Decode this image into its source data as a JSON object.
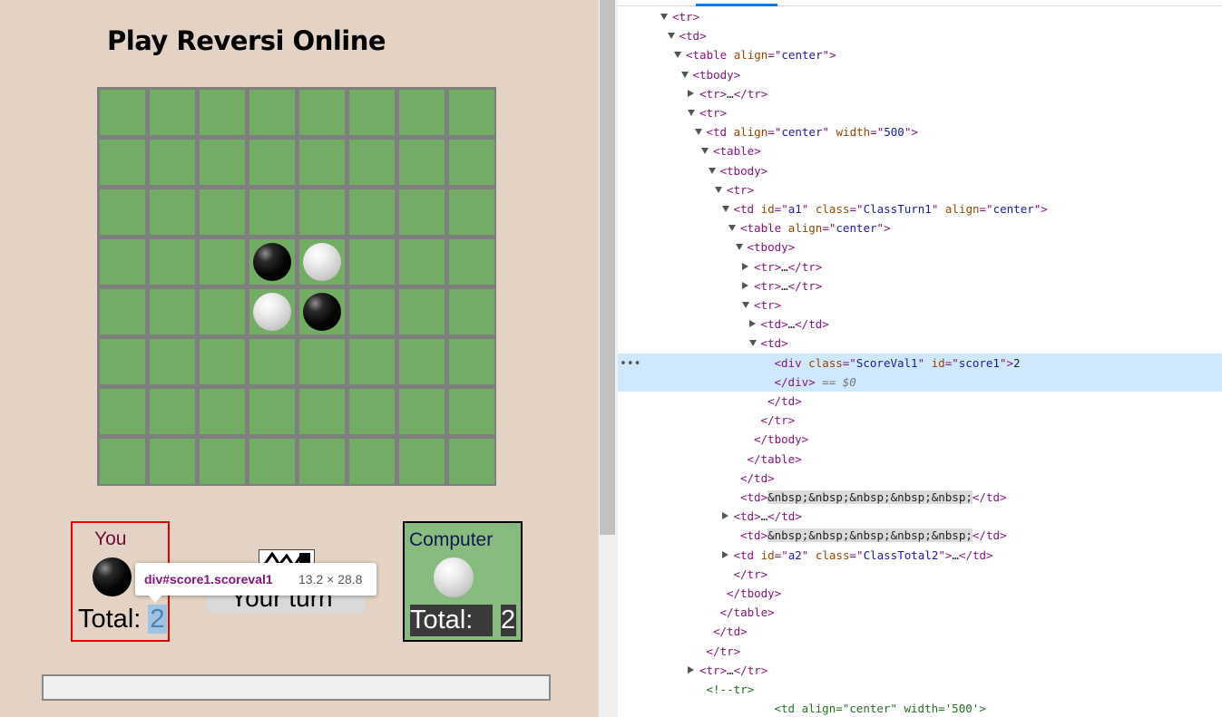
{
  "game": {
    "title": "Play Reversi Online",
    "board": {
      "rows": 8,
      "cols": 8,
      "discs": [
        {
          "row": 3,
          "col": 3,
          "color": "black"
        },
        {
          "row": 3,
          "col": 4,
          "color": "white"
        },
        {
          "row": 4,
          "col": 3,
          "color": "white"
        },
        {
          "row": 4,
          "col": 4,
          "color": "black"
        }
      ]
    },
    "player": {
      "label": "You",
      "total_label": "Total:",
      "score": "2"
    },
    "computer": {
      "label": "Computer",
      "total_label": "Total:",
      "score": "2"
    },
    "turn_text": "Your turn",
    "tooltip": {
      "selector": "div#score1.scoreval1",
      "size": "13.2 × 28.8"
    }
  },
  "colors": {
    "board_green": "#73ac65",
    "grid_gray": "#7f7f7f",
    "page_bg": "#e4d3c4",
    "player_border": "#e00000",
    "computer_bg": "#88bb80",
    "selection_highlight": "#cfe8fc"
  },
  "devtools": {
    "highlighted_line": 18,
    "lines": [
      {
        "indent": 8,
        "tri": "down",
        "html": "<span class='t'>&lt;tr&gt;</span>"
      },
      {
        "indent": 9,
        "tri": "down",
        "html": "<span class='t'>&lt;td&gt;</span>"
      },
      {
        "indent": 10,
        "tri": "down",
        "html": "<span class='t'>&lt;table </span><span class='a'>align</span><span class='t'>=\"</span><span class='v'>center</span><span class='t'>\"&gt;</span>"
      },
      {
        "indent": 11,
        "tri": "down",
        "html": "<span class='t'>&lt;tbody&gt;</span>"
      },
      {
        "indent": 12,
        "tri": "right",
        "html": "<span class='t'>&lt;tr&gt;</span><span class='k'>…</span><span class='t'>&lt;/tr&gt;</span>"
      },
      {
        "indent": 12,
        "tri": "down",
        "html": "<span class='t'>&lt;tr&gt;</span>"
      },
      {
        "indent": 13,
        "tri": "down",
        "html": "<span class='t'>&lt;td </span><span class='a'>align</span><span class='t'>=\"</span><span class='v'>center</span><span class='t'>\" </span><span class='a'>width</span><span class='t'>=\"</span><span class='v'>500</span><span class='t'>\"&gt;</span>"
      },
      {
        "indent": 14,
        "tri": "down",
        "html": "<span class='t'>&lt;table&gt;</span>"
      },
      {
        "indent": 15,
        "tri": "down",
        "html": "<span class='t'>&lt;tbody&gt;</span>"
      },
      {
        "indent": 16,
        "tri": "down",
        "html": "<span class='t'>&lt;tr&gt;</span>"
      },
      {
        "indent": 17,
        "tri": "down",
        "html": "<span class='t'>&lt;td </span><span class='a'>id</span><span class='t'>=\"</span><span class='v'>a1</span><span class='t'>\" </span><span class='a'>class</span><span class='t'>=\"</span><span class='v'>ClassTurn1</span><span class='t'>\" </span><span class='a'>align</span><span class='t'>=\"</span><span class='v'>center</span><span class='t'>\"&gt;</span>"
      },
      {
        "indent": 18,
        "tri": "down",
        "html": "<span class='t'>&lt;table </span><span class='a'>align</span><span class='t'>=\"</span><span class='v'>center</span><span class='t'>\"&gt;</span>"
      },
      {
        "indent": 19,
        "tri": "down",
        "html": "<span class='t'>&lt;tbody&gt;</span>"
      },
      {
        "indent": 20,
        "tri": "right",
        "html": "<span class='t'>&lt;tr&gt;</span><span class='k'>…</span><span class='t'>&lt;/tr&gt;</span>"
      },
      {
        "indent": 20,
        "tri": "right",
        "html": "<span class='t'>&lt;tr&gt;</span><span class='k'>…</span><span class='t'>&lt;/tr&gt;</span>"
      },
      {
        "indent": 20,
        "tri": "down",
        "html": "<span class='t'>&lt;tr&gt;</span>"
      },
      {
        "indent": 21,
        "tri": "right",
        "html": "<span class='t'>&lt;td&gt;</span><span class='k'>…</span><span class='t'>&lt;/td&gt;</span>"
      },
      {
        "indent": 21,
        "tri": "down",
        "html": "<span class='t'>&lt;td&gt;</span>"
      },
      {
        "indent": 23,
        "tri": "",
        "html": "<span class='t'>&lt;div </span><span class='a'>class</span><span class='t'>=\"</span><span class='v'>ScoreVal1</span><span class='t'>\" </span><span class='a'>id</span><span class='t'>=\"</span><span class='v'>score1</span><span class='t'>\"&gt;</span><span class='k'>2</span>"
      },
      {
        "indent": 23,
        "tri": "",
        "html": "<span class='t'>&lt;/div&gt;</span><span class='g'> == $0</span>"
      },
      {
        "indent": 22,
        "tri": "",
        "html": "<span class='t'>&lt;/td&gt;</span>"
      },
      {
        "indent": 21,
        "tri": "",
        "html": "<span class='t'>&lt;/tr&gt;</span>"
      },
      {
        "indent": 20,
        "tri": "",
        "html": "<span class='t'>&lt;/tbody&gt;</span>"
      },
      {
        "indent": 19,
        "tri": "",
        "html": "<span class='t'>&lt;/table&gt;</span>"
      },
      {
        "indent": 18,
        "tri": "",
        "html": "<span class='t'>&lt;/td&gt;</span>"
      },
      {
        "indent": 18,
        "tri": "",
        "html": "<span class='t'>&lt;td&gt;</span><span class='n'>&amp;nbsp;&amp;nbsp;&amp;nbsp;&amp;nbsp;&amp;nbsp;</span><span class='t'>&lt;/td&gt;</span>"
      },
      {
        "indent": 17,
        "tri": "right",
        "html": "<span class='t'>&lt;td&gt;</span><span class='k'>…</span><span class='t'>&lt;/td&gt;</span>"
      },
      {
        "indent": 18,
        "tri": "",
        "html": "<span class='t'>&lt;td&gt;</span><span class='n'>&amp;nbsp;&amp;nbsp;&amp;nbsp;&amp;nbsp;&amp;nbsp;</span><span class='t'>&lt;/td&gt;</span>"
      },
      {
        "indent": 17,
        "tri": "right",
        "html": "<span class='t'>&lt;td </span><span class='a'>id</span><span class='t'>=\"</span><span class='v'>a2</span><span class='t'>\" </span><span class='a'>class</span><span class='t'>=\"</span><span class='v'>ClassTotal2</span><span class='t'>\"&gt;</span><span class='k'>…</span><span class='t'>&lt;/td&gt;</span>"
      },
      {
        "indent": 17,
        "tri": "",
        "html": "<span class='t'>&lt;/tr&gt;</span>"
      },
      {
        "indent": 16,
        "tri": "",
        "html": "<span class='t'>&lt;/tbody&gt;</span>"
      },
      {
        "indent": 15,
        "tri": "",
        "html": "<span class='t'>&lt;/table&gt;</span>"
      },
      {
        "indent": 14,
        "tri": "",
        "html": "<span class='t'>&lt;/td&gt;</span>"
      },
      {
        "indent": 13,
        "tri": "",
        "html": "<span class='t'>&lt;/tr&gt;</span>"
      },
      {
        "indent": 12,
        "tri": "right",
        "html": "<span class='t'>&lt;tr&gt;</span><span class='k'>…</span><span class='t'>&lt;/tr&gt;</span>"
      },
      {
        "indent": 13,
        "tri": "",
        "html": "<span class='c'>&lt;!--tr&gt;</span>"
      },
      {
        "indent": 23,
        "tri": "",
        "html": "<span class='c'>&lt;td align=\"center\" width='500'&gt;</span>"
      }
    ]
  }
}
